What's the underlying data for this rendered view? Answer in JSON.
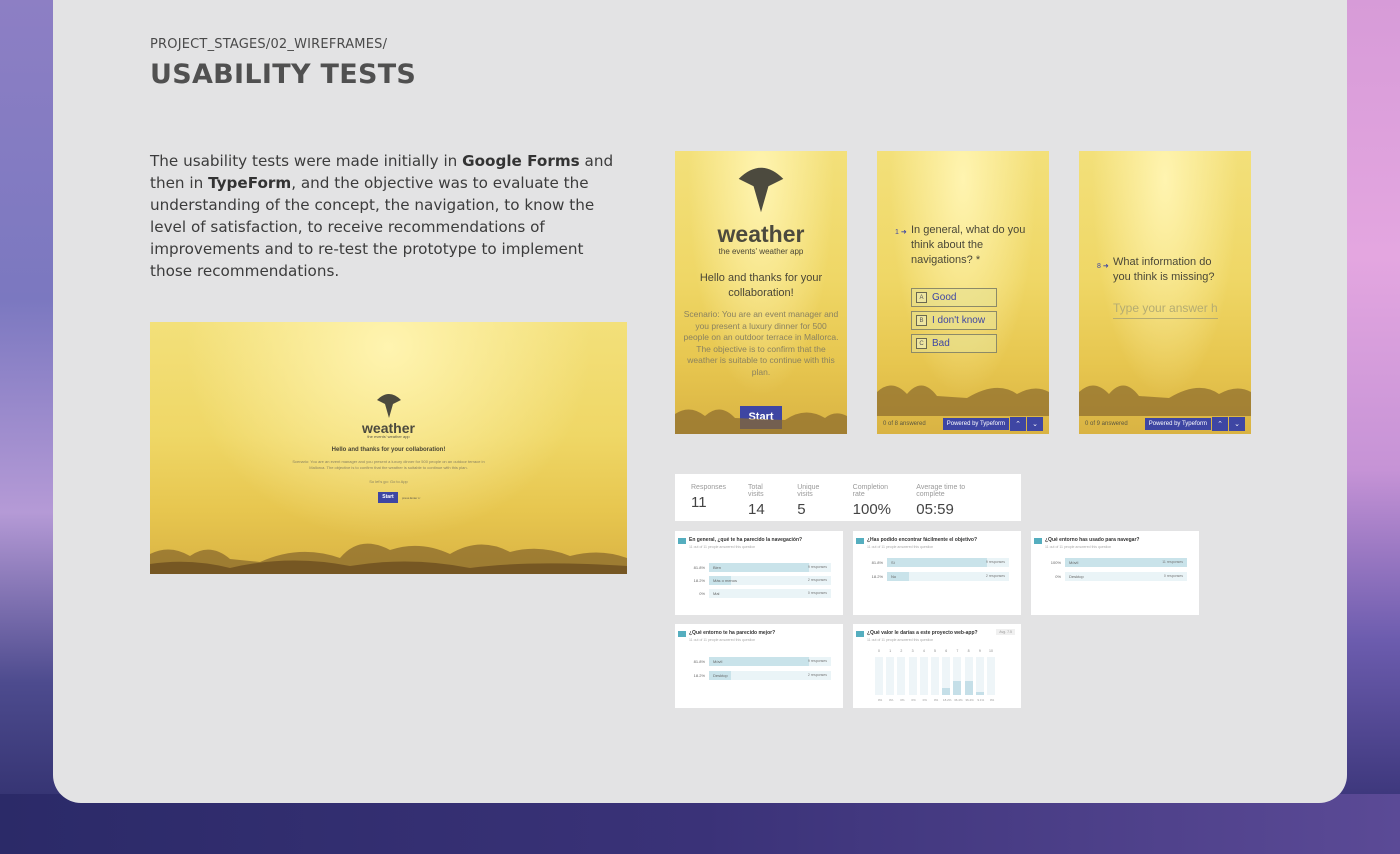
{
  "header": {
    "breadcrumb": "PROJECT_STAGES/02_WIREFRAMES/",
    "title": "USABILITY TESTS"
  },
  "description": {
    "part1": "The usability tests were made initially in ",
    "bold1": "Google Forms",
    "part2": " and then in ",
    "bold2": "TypeForm",
    "part3": ", and the objective was to evaluate the understanding of the concept, the navigation, to know the level of satisfaction, to receive recommendations of improvements and to re-test the prototype to implement those recommendations."
  },
  "desktop_shot": {
    "logo": "weather",
    "tagline": "the events' weather app",
    "greeting": "Hello and thanks for your collaboration!",
    "scenario": "Scenario: You are an event manager and you present a luxury dinner for 500 people on an outdoor terrace in Mallorca. The objective is to confirm that the weather is suitable to continue with this plan.",
    "link": "So let's go: Go to App",
    "start": "Start",
    "hint": "press Enter ↵"
  },
  "phone1": {
    "logo": "weather",
    "tagline": "the events' weather app",
    "greeting": "Hello and thanks for your collaboration!",
    "scenario": "Scenario: You are an event manager and you present a luxury dinner for 500 people on an outdoor terrace in Mallorca. The objective is to confirm that the weather is suitable to continue with this plan.",
    "start": "Start"
  },
  "phone2": {
    "number": "1 ➜",
    "question": "In general, what do you think about the navigations? *",
    "choices": [
      {
        "key": "A",
        "label": "Good"
      },
      {
        "key": "B",
        "label": "I don't know"
      },
      {
        "key": "C",
        "label": "Bad"
      }
    ],
    "progress": "0 of 8 answered",
    "powered": "Powered by Typeform"
  },
  "phone3": {
    "number": "8 ➜",
    "question": "What information do you think is missing?",
    "placeholder": "Type your answer h",
    "progress": "0 of 9 answered",
    "powered": "Powered by Typeform"
  },
  "stats": [
    {
      "label": "Responses",
      "value": "11"
    },
    {
      "label": "Total visits",
      "value": "14"
    },
    {
      "label": "Unique visits",
      "value": "5"
    },
    {
      "label": "Completion rate",
      "value": "100%"
    },
    {
      "label": "Average time to complete",
      "value": "05:59"
    }
  ],
  "results": {
    "r1": {
      "question": "En general, ¿qué te ha parecido la navegación?",
      "sub": "11 out of 11 people answered this question",
      "rows": [
        {
          "pct": "81.8%",
          "label": "Bien",
          "fill": 0.82,
          "resp": "9 responses"
        },
        {
          "pct": "18.2%",
          "label": "Más o menos",
          "fill": 0.18,
          "resp": "2 responses"
        },
        {
          "pct": "0%",
          "label": "Mal",
          "fill": 0.0,
          "resp": "0 responses"
        }
      ]
    },
    "r2": {
      "question": "¿Has podido encontrar fácilmente el objetivo?",
      "sub": "11 out of 11 people answered this question",
      "rows": [
        {
          "pct": "81.8%",
          "label": "Sí",
          "fill": 0.82,
          "resp": "9 responses"
        },
        {
          "pct": "18.2%",
          "label": "No",
          "fill": 0.18,
          "resp": "2 responses"
        }
      ]
    },
    "r3": {
      "question": "¿Qué entorno has usado para navegar?",
      "sub": "11 out of 11 people answered this question",
      "rows": [
        {
          "pct": "100%",
          "label": "Móvil",
          "fill": 1.0,
          "resp": "11 responses"
        },
        {
          "pct": "0%",
          "label": "Desktop",
          "fill": 0.0,
          "resp": "0 responses"
        }
      ]
    },
    "r4": {
      "question": "¿Qué entorno te ha parecido mejor?",
      "sub": "11 out of 11 people answered this question",
      "rows": [
        {
          "pct": "81.8%",
          "label": "Móvil",
          "fill": 0.82,
          "resp": "9 responses"
        },
        {
          "pct": "18.2%",
          "label": "Desktop",
          "fill": 0.18,
          "resp": "2 responses"
        }
      ]
    },
    "r5": {
      "question": "¿Qué valor le darías a este proyecto web-app?",
      "sub": "11 out of 11 people answered this question",
      "badge": "Avg. 7.5",
      "cols": [
        {
          "n": "0",
          "p": "0%",
          "fill": 0.0
        },
        {
          "n": "1",
          "p": "0%",
          "fill": 0.0
        },
        {
          "n": "2",
          "p": "0%",
          "fill": 0.0
        },
        {
          "n": "3",
          "p": "0%",
          "fill": 0.0
        },
        {
          "n": "4",
          "p": "0%",
          "fill": 0.0
        },
        {
          "n": "5",
          "p": "0%",
          "fill": 0.0
        },
        {
          "n": "6",
          "p": "18.2%",
          "fill": 0.18
        },
        {
          "n": "7",
          "p": "36.4%",
          "fill": 0.36
        },
        {
          "n": "8",
          "p": "36.4%",
          "fill": 0.36
        },
        {
          "n": "9",
          "p": "9.1%",
          "fill": 0.09
        },
        {
          "n": "10",
          "p": "0%",
          "fill": 0.0
        }
      ]
    }
  },
  "colors": {
    "card": "#e3e3e4",
    "accent": "#3e46a3",
    "yellow": "#efd766",
    "bar": "#c9e3ea"
  }
}
